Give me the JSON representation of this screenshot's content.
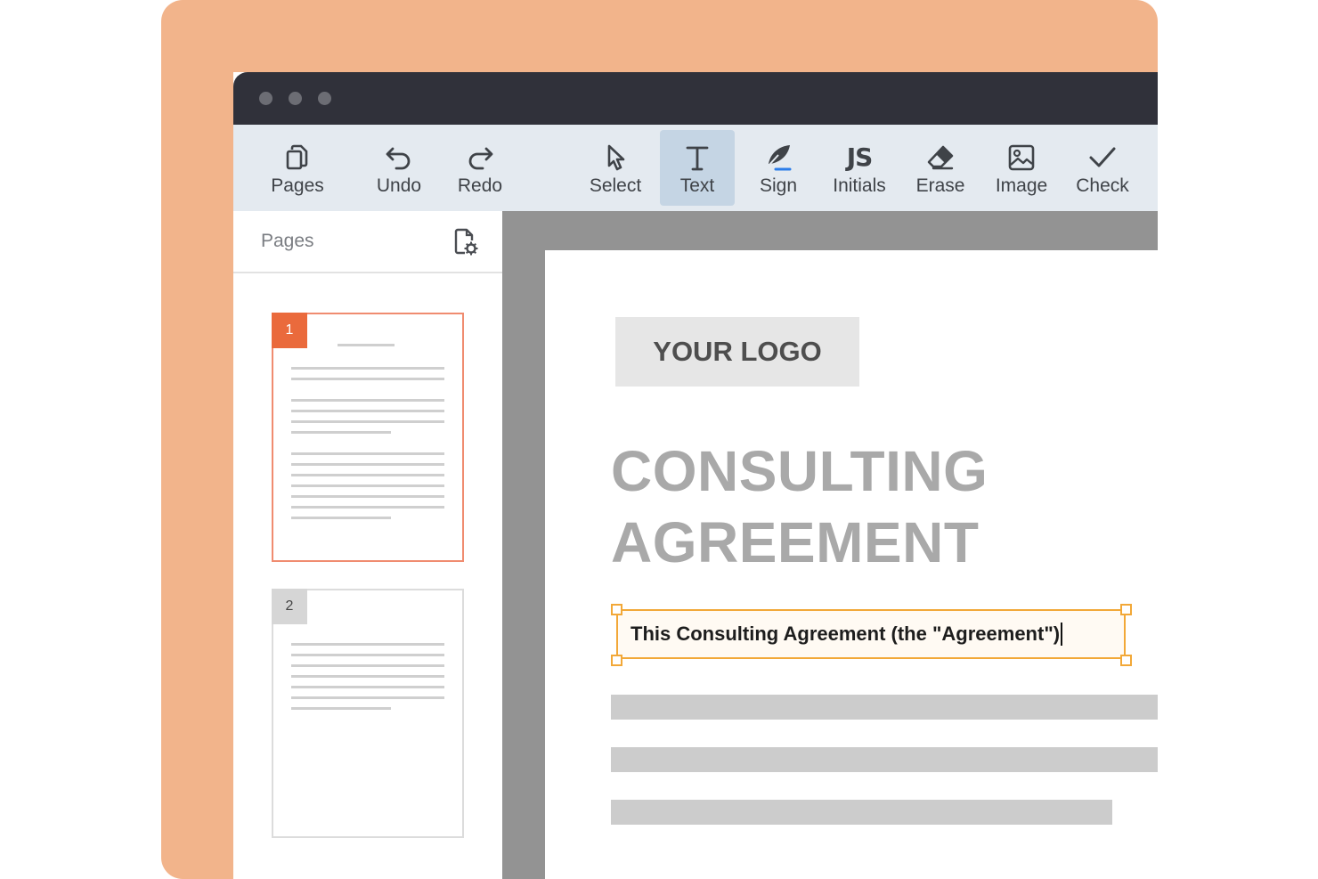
{
  "toolbar": {
    "items": [
      {
        "label": "Pages",
        "icon": "pages-icon"
      },
      {
        "label": "Undo",
        "icon": "undo-icon"
      },
      {
        "label": "Redo",
        "icon": "redo-icon"
      },
      {
        "label": "Select",
        "icon": "cursor-icon"
      },
      {
        "label": "Text",
        "icon": "text-icon",
        "active": true
      },
      {
        "label": "Sign",
        "icon": "quill-icon"
      },
      {
        "label": "Initials",
        "icon": "initials-icon",
        "glyph": "JS"
      },
      {
        "label": "Erase",
        "icon": "eraser-icon"
      },
      {
        "label": "Image",
        "icon": "image-icon"
      },
      {
        "label": "Check",
        "icon": "check-icon"
      }
    ]
  },
  "sidebar": {
    "title": "Pages",
    "pages": [
      {
        "number": "1",
        "active": true
      },
      {
        "number": "2",
        "active": false
      }
    ]
  },
  "document": {
    "logo_text": "YOUR LOGO",
    "title_line1": "CONSULTING",
    "title_line2": "AGREEMENT",
    "text_field_value": "This Consulting Agreement (the \"Agreement\")"
  },
  "colors": {
    "frame": "#f2b48b",
    "accent": "#ea6a3c",
    "selection": "#f2a838",
    "titlebar": "#30313a"
  }
}
